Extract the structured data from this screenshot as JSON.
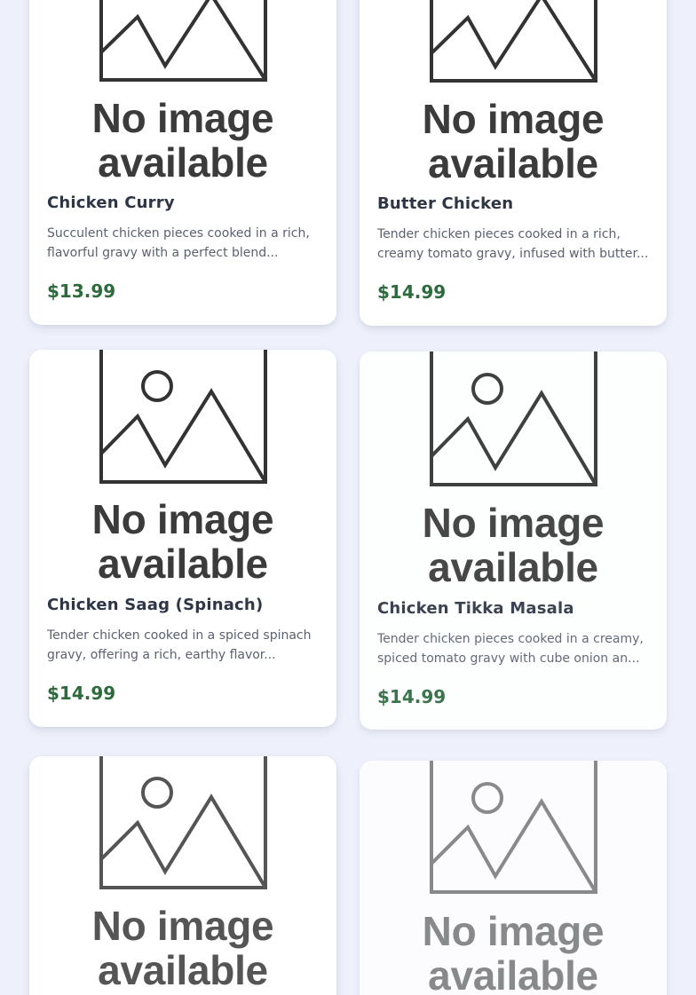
{
  "placeholder": {
    "line1": "No image",
    "line2": "available"
  },
  "colors": {
    "background": "#eef1fb",
    "price": "#2d6b3d",
    "title": "#2e3646",
    "description": "#5b6170"
  },
  "menu_items": [
    {
      "name": "Chicken Curry",
      "description": "Succulent chicken pieces cooked in a rich, flavorful gravy with a perfect blend...",
      "price": "$13.99"
    },
    {
      "name": "Butter Chicken",
      "description": "Tender chicken pieces cooked in a rich, creamy tomato gravy, infused with butter...",
      "price": "$14.99"
    },
    {
      "name": "Chicken Saag (Spinach)",
      "description": "Tender chicken cooked in a spiced spinach gravy, offering a rich, earthy flavor...",
      "price": "$14.99"
    },
    {
      "name": "Chicken Tikka Masala",
      "description": "Tender chicken pieces cooked in a creamy, spiced tomato gravy with cube onion an...",
      "price": "$14.99"
    },
    {
      "name": "",
      "description": "",
      "price": ""
    },
    {
      "name": "",
      "description": "",
      "price": ""
    }
  ]
}
